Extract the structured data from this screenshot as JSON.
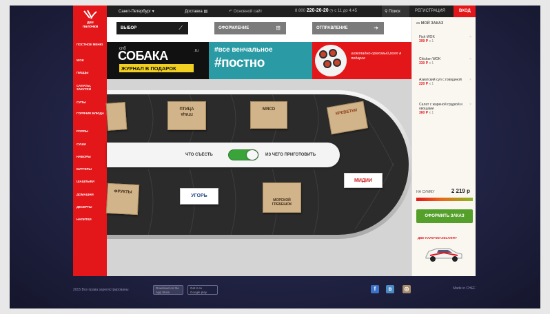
{
  "topbar": {
    "city": "Санкт-Петербург",
    "delivery": "Доставка",
    "main_site": "Основной сайт",
    "phone_prefix": "8 800",
    "phone_number": "220-20-20",
    "hours": "с 11 до 4:45",
    "search": "Поиск",
    "register": "РЕГИСТРАЦИЯ",
    "login": "ВХОД"
  },
  "logo": {
    "line1": "две",
    "line2": "палочки"
  },
  "nav": {
    "items": [
      "ПОСТНОЕ МЕНЮ",
      "WOK",
      "ПИЦЦЫ",
      "САЛАТЫ, ЗАКУСКИ",
      "СУПЫ",
      "ГОРЯЧИЕ БЛЮДА",
      "РОЛЛЫ",
      "СУШИ",
      "НАБОРЫ",
      "БУРГЕРЫ",
      "ШАШЛЫКИ",
      "ДОМАШНИ",
      "ДЕСЕРТЫ",
      "НАПИТКИ"
    ]
  },
  "steps": {
    "step1": "ВЫБОР",
    "step2": "ОФОРМЛЕНИЕ",
    "step3": "ОТПРАВЛЕНИЕ"
  },
  "banner": {
    "spb": "спб",
    "sobaka": "СОБАКА",
    "ru": ".ru",
    "gift": "ЖУРНАЛ В ПОДАРОК",
    "hashtag": "#все венчальное",
    "postno": "#постно",
    "promo": "шоколадно-ореховый ролл в подарок"
  },
  "belt": {
    "card_bird": "ПТИЦА",
    "card_bird_flip": "ПТИЦА",
    "card_meat": "МЯСО",
    "card_shrimp": "КРЕВЕТКИ",
    "card_fruits": "ФРУКТЫ",
    "card_eel": "УГОРЬ",
    "card_seafood": "МОРСКОЙ ГРЕБЕШОК",
    "card_mussels": "МИДИИ",
    "switch_left": "ЧТО СЪЕСТЬ",
    "switch_right": "ИЗ ЧЕГО ПРИГОТОВИТЬ"
  },
  "cart": {
    "title": "МОЙ ЗАКАЗ",
    "items": [
      {
        "name": "Fish WOK",
        "price": "399 Р",
        "qty": "x 1"
      },
      {
        "name": "Chicken WOK",
        "price": "330 Р",
        "qty": "x 1"
      },
      {
        "name": "Азиатский суп с говядиной",
        "price": "220 Р",
        "qty": "x 1"
      },
      {
        "name": "Салат с жареной грудкой и овощами",
        "price": "360 Р",
        "qty": "x 1"
      }
    ],
    "sum_label": "НА СУММУ",
    "sum_value": "2 219 р",
    "order_button": "ОФОРМИТЬ ЗАКАЗ",
    "delivery": "ДВЕ ПАЛОЧКИ DELIVERY"
  },
  "footer": {
    "copyright": "2015 Все права зарегистрированы",
    "appstore": "App Store",
    "appstore_top": "Download on the",
    "googleplay": "Google play",
    "googleplay_top": "Get it on",
    "madein": "Made in CHEF"
  },
  "colors": {
    "brand_red": "#e3161a",
    "order_green": "#54a02a",
    "toggle_green": "#3aa33a"
  }
}
